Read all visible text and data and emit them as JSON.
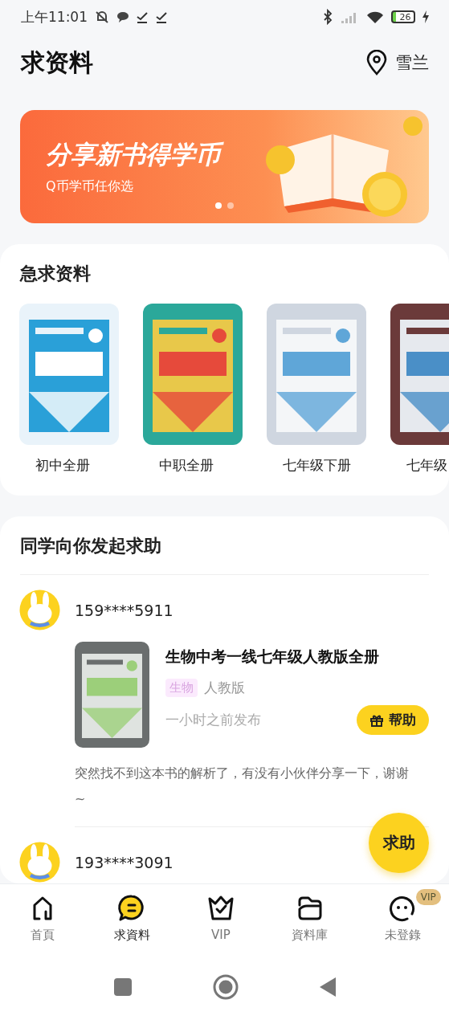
{
  "status_bar": {
    "time": "上午11:01",
    "battery": "26"
  },
  "header": {
    "title": "求资料",
    "location": "雪兰"
  },
  "banner": {
    "headline": "分享新书得学币",
    "subline": "Q币学币任你选",
    "dots": [
      {
        "selected": true
      },
      {
        "selected": false
      }
    ]
  },
  "urgent": {
    "title": "急求资料",
    "books": [
      {
        "label": "初中全册"
      },
      {
        "label": "中职全册"
      },
      {
        "label": "七年级下册"
      },
      {
        "label": "七年级"
      }
    ]
  },
  "requests": {
    "title": "同学向你发起求助",
    "posts": [
      {
        "user": "159****5911",
        "book": {
          "title": "生物中考一线七年级人教版全册",
          "subject": "生物",
          "edition": "人教版",
          "time": "一小时之前发布",
          "help": "帮助"
        },
        "message": "突然找不到这本书的解析了，有没有小伙伴分享一下，谢谢~"
      },
      {
        "user": "193****3091"
      }
    ]
  },
  "fab": "求助",
  "tabs": [
    {
      "label": "首頁",
      "kind": "home",
      "selected": false
    },
    {
      "label": "求資料",
      "kind": "chat",
      "selected": true
    },
    {
      "label": "VIP",
      "kind": "crown",
      "selected": false
    },
    {
      "label": "資料庫",
      "kind": "folder",
      "selected": false
    },
    {
      "label": "未登錄",
      "kind": "face",
      "selected": false,
      "badge": "VIP"
    }
  ]
}
